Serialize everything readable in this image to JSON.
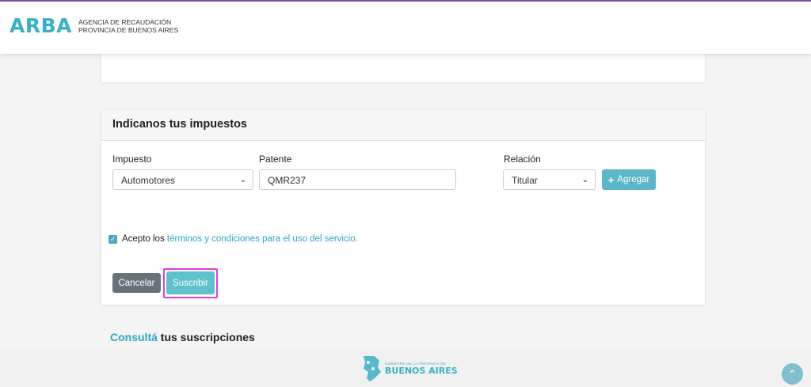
{
  "header": {
    "logo_text": "ARBA",
    "logo_line1": "AGENCIA DE RECAUDACIÓN",
    "logo_line2": "PROVINCIA DE BUENOS AIRES"
  },
  "taxes_card": {
    "title": "Indicanos tus impuestos",
    "impuesto_label": "Impuesto",
    "impuesto_value": "Automotores",
    "patente_label": "Patente",
    "patente_value": "QMR237",
    "relacion_label": "Relación",
    "relacion_value": "Titular",
    "add_button": "Agregar",
    "terms_prefix": "Acepto los ",
    "terms_link": "términos y condiciones para el uso del servicio.",
    "terms_checked": true,
    "cancel_button": "Cancelar",
    "subscribe_button": "Suscribir"
  },
  "consulta": {
    "link_text": "Consultá",
    "rest_text": " tus suscripciones"
  },
  "footer": {
    "logo_small": "GOBIERNO DE LA PROVINCIA DE",
    "logo_big": "BUENOS AIRES"
  },
  "colors": {
    "accent": "#3ab0c8",
    "highlight": "#e23ce0",
    "cancel": "#6b7178"
  },
  "icons": {
    "scroll_top": "chevron-up-icon",
    "add": "plus-icon",
    "select_arrow": "chevron-down-icon",
    "checkbox": "check-icon"
  }
}
